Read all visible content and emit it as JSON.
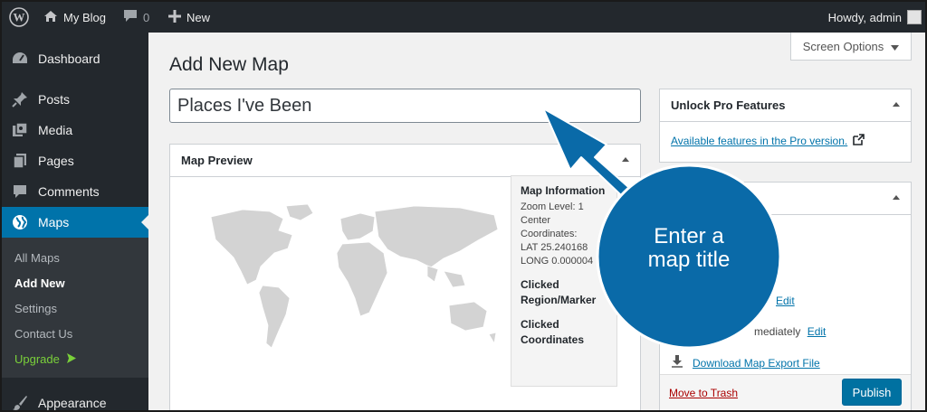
{
  "adminbar": {
    "site_name": "My Blog",
    "comment_count": "0",
    "new_label": "New",
    "howdy": "Howdy, admin"
  },
  "sidebar": {
    "items": [
      {
        "label": "Dashboard",
        "icon": "dashboard-icon"
      },
      {
        "label": "Posts",
        "icon": "pin-icon"
      },
      {
        "label": "Media",
        "icon": "media-icon"
      },
      {
        "label": "Pages",
        "icon": "pages-icon"
      },
      {
        "label": "Comments",
        "icon": "comment-icon"
      },
      {
        "label": "Maps",
        "icon": "globe-icon",
        "active": true
      },
      {
        "label": "Appearance",
        "icon": "brush-icon"
      }
    ],
    "submenu": [
      {
        "label": "All Maps"
      },
      {
        "label": "Add New",
        "current": true
      },
      {
        "label": "Settings"
      },
      {
        "label": "Contact Us"
      },
      {
        "label": "Upgrade",
        "icon": "arrow-right-icon"
      }
    ]
  },
  "header": {
    "screen_options": "Screen Options",
    "page_title": "Add New Map"
  },
  "title_input": {
    "value": "Places I've Been"
  },
  "map_preview": {
    "heading": "Map Preview",
    "info_title": "Map Information",
    "zoom_level": "Zoom Level: 1",
    "center_label": "Center Coordinates:",
    "lat": "LAT 25.240168",
    "long": "LONG 0.000004",
    "clicked_region": "Clicked Region/Marker",
    "clicked_coords": "Clicked Coordinates"
  },
  "pro_box": {
    "heading": "Unlock Pro Features",
    "link": "Available features in the Pro version."
  },
  "publish_box": {
    "edit_1": "Edit",
    "immediately": "mediately",
    "edit_2": "Edit",
    "download": "Download Map Export File",
    "trash": "Move to Trash",
    "publish": "Publish"
  },
  "callout": {
    "text": "Enter a map title"
  },
  "colors": {
    "adminbar": "#23282d",
    "active": "#0073aa",
    "callout": "#0a6aa8"
  }
}
